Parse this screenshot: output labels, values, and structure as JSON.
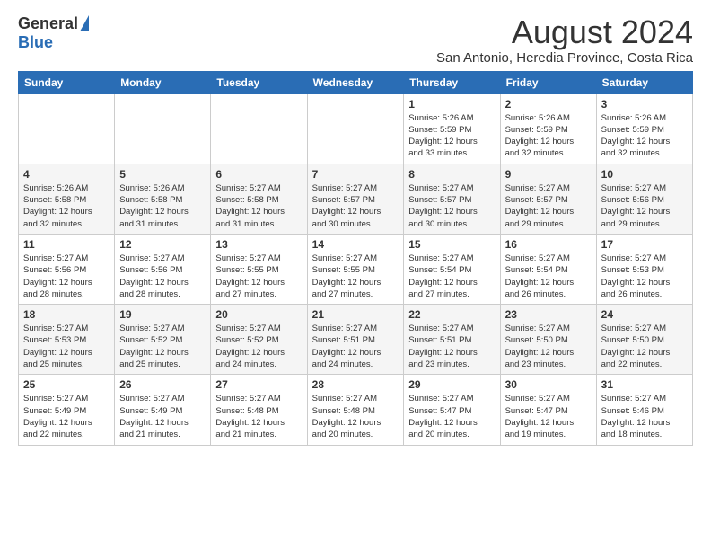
{
  "header": {
    "logo": {
      "general": "General",
      "blue": "Blue"
    },
    "title": "August 2024",
    "subtitle": "San Antonio, Heredia Province, Costa Rica"
  },
  "days_of_week": [
    "Sunday",
    "Monday",
    "Tuesday",
    "Wednesday",
    "Thursday",
    "Friday",
    "Saturday"
  ],
  "weeks": [
    [
      {
        "day": "",
        "info": ""
      },
      {
        "day": "",
        "info": ""
      },
      {
        "day": "",
        "info": ""
      },
      {
        "day": "",
        "info": ""
      },
      {
        "day": "1",
        "info": "Sunrise: 5:26 AM\nSunset: 5:59 PM\nDaylight: 12 hours\nand 33 minutes."
      },
      {
        "day": "2",
        "info": "Sunrise: 5:26 AM\nSunset: 5:59 PM\nDaylight: 12 hours\nand 32 minutes."
      },
      {
        "day": "3",
        "info": "Sunrise: 5:26 AM\nSunset: 5:59 PM\nDaylight: 12 hours\nand 32 minutes."
      }
    ],
    [
      {
        "day": "4",
        "info": "Sunrise: 5:26 AM\nSunset: 5:58 PM\nDaylight: 12 hours\nand 32 minutes."
      },
      {
        "day": "5",
        "info": "Sunrise: 5:26 AM\nSunset: 5:58 PM\nDaylight: 12 hours\nand 31 minutes."
      },
      {
        "day": "6",
        "info": "Sunrise: 5:27 AM\nSunset: 5:58 PM\nDaylight: 12 hours\nand 31 minutes."
      },
      {
        "day": "7",
        "info": "Sunrise: 5:27 AM\nSunset: 5:57 PM\nDaylight: 12 hours\nand 30 minutes."
      },
      {
        "day": "8",
        "info": "Sunrise: 5:27 AM\nSunset: 5:57 PM\nDaylight: 12 hours\nand 30 minutes."
      },
      {
        "day": "9",
        "info": "Sunrise: 5:27 AM\nSunset: 5:57 PM\nDaylight: 12 hours\nand 29 minutes."
      },
      {
        "day": "10",
        "info": "Sunrise: 5:27 AM\nSunset: 5:56 PM\nDaylight: 12 hours\nand 29 minutes."
      }
    ],
    [
      {
        "day": "11",
        "info": "Sunrise: 5:27 AM\nSunset: 5:56 PM\nDaylight: 12 hours\nand 28 minutes."
      },
      {
        "day": "12",
        "info": "Sunrise: 5:27 AM\nSunset: 5:56 PM\nDaylight: 12 hours\nand 28 minutes."
      },
      {
        "day": "13",
        "info": "Sunrise: 5:27 AM\nSunset: 5:55 PM\nDaylight: 12 hours\nand 27 minutes."
      },
      {
        "day": "14",
        "info": "Sunrise: 5:27 AM\nSunset: 5:55 PM\nDaylight: 12 hours\nand 27 minutes."
      },
      {
        "day": "15",
        "info": "Sunrise: 5:27 AM\nSunset: 5:54 PM\nDaylight: 12 hours\nand 27 minutes."
      },
      {
        "day": "16",
        "info": "Sunrise: 5:27 AM\nSunset: 5:54 PM\nDaylight: 12 hours\nand 26 minutes."
      },
      {
        "day": "17",
        "info": "Sunrise: 5:27 AM\nSunset: 5:53 PM\nDaylight: 12 hours\nand 26 minutes."
      }
    ],
    [
      {
        "day": "18",
        "info": "Sunrise: 5:27 AM\nSunset: 5:53 PM\nDaylight: 12 hours\nand 25 minutes."
      },
      {
        "day": "19",
        "info": "Sunrise: 5:27 AM\nSunset: 5:52 PM\nDaylight: 12 hours\nand 25 minutes."
      },
      {
        "day": "20",
        "info": "Sunrise: 5:27 AM\nSunset: 5:52 PM\nDaylight: 12 hours\nand 24 minutes."
      },
      {
        "day": "21",
        "info": "Sunrise: 5:27 AM\nSunset: 5:51 PM\nDaylight: 12 hours\nand 24 minutes."
      },
      {
        "day": "22",
        "info": "Sunrise: 5:27 AM\nSunset: 5:51 PM\nDaylight: 12 hours\nand 23 minutes."
      },
      {
        "day": "23",
        "info": "Sunrise: 5:27 AM\nSunset: 5:50 PM\nDaylight: 12 hours\nand 23 minutes."
      },
      {
        "day": "24",
        "info": "Sunrise: 5:27 AM\nSunset: 5:50 PM\nDaylight: 12 hours\nand 22 minutes."
      }
    ],
    [
      {
        "day": "25",
        "info": "Sunrise: 5:27 AM\nSunset: 5:49 PM\nDaylight: 12 hours\nand 22 minutes."
      },
      {
        "day": "26",
        "info": "Sunrise: 5:27 AM\nSunset: 5:49 PM\nDaylight: 12 hours\nand 21 minutes."
      },
      {
        "day": "27",
        "info": "Sunrise: 5:27 AM\nSunset: 5:48 PM\nDaylight: 12 hours\nand 21 minutes."
      },
      {
        "day": "28",
        "info": "Sunrise: 5:27 AM\nSunset: 5:48 PM\nDaylight: 12 hours\nand 20 minutes."
      },
      {
        "day": "29",
        "info": "Sunrise: 5:27 AM\nSunset: 5:47 PM\nDaylight: 12 hours\nand 20 minutes."
      },
      {
        "day": "30",
        "info": "Sunrise: 5:27 AM\nSunset: 5:47 PM\nDaylight: 12 hours\nand 19 minutes."
      },
      {
        "day": "31",
        "info": "Sunrise: 5:27 AM\nSunset: 5:46 PM\nDaylight: 12 hours\nand 18 minutes."
      }
    ]
  ]
}
